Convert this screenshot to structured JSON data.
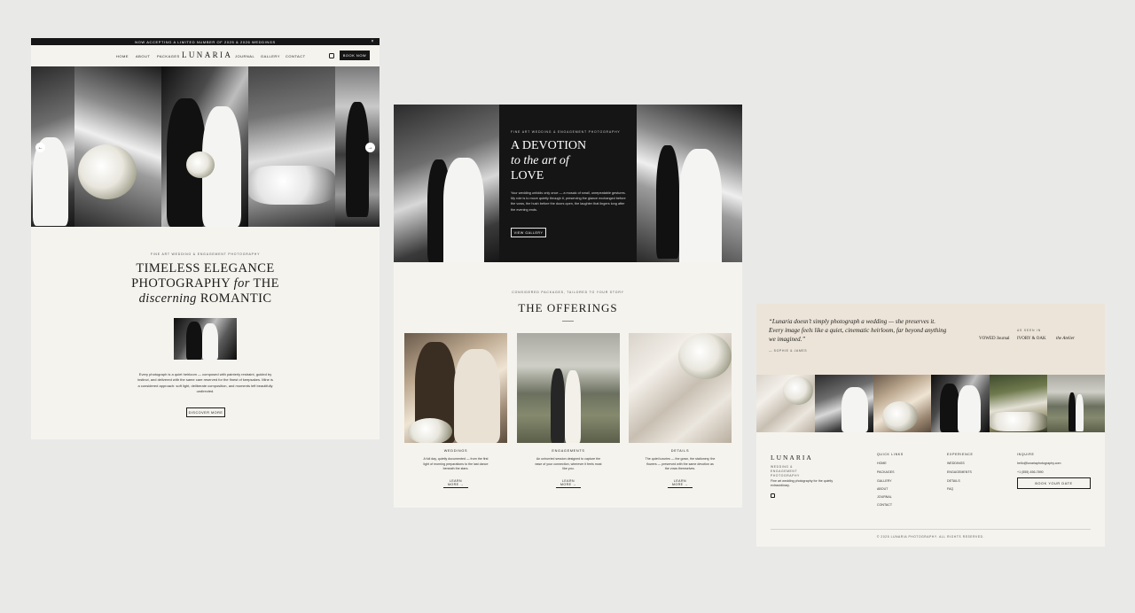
{
  "panel1": {
    "announcement": "NOW ACCEPTING A LIMITED NUMBER OF 2025 & 2026 WEDDINGS",
    "close_glyph": "×",
    "nav_left": [
      "HOME",
      "ABOUT",
      "PACKAGES"
    ],
    "logo": "LUNARIA",
    "nav_right": [
      "JOURNAL",
      "GALLERY",
      "CONTACT"
    ],
    "book_label": "BOOK NOW",
    "prev_glyph": "←",
    "next_glyph": "→",
    "eyebrow": "FINE ART WEDDING & ENGAGEMENT PHOTOGRAPHY",
    "headline": {
      "line1": "TIMELESS ELEGANCE",
      "line2a": "PHOTOGRAPHY ",
      "line2b": "for",
      "line2c": " THE",
      "line3a": "discerning",
      "line3b": " ROMANTIC"
    },
    "body": "Every photograph is a quiet heirloom — composed with painterly restraint, guided by instinct, and delivered with the same care reserved for the finest of keepsakes. Mine is a considered approach: soft light, deliberate composition, and moments left beautifully undirected.",
    "cta": "DISCOVER MORE"
  },
  "panel2": {
    "eyebrow": "FINE ART WEDDING & ENGAGEMENT PHOTOGRAPHY",
    "title": {
      "line1": "A DEVOTION",
      "line2": "to the art of",
      "line3": "LOVE"
    },
    "body": "Your wedding unfolds only once — a mosaic of small, unrepeatable gestures. My role is to move quietly through it, preserving the glance exchanged before the vows, the hush before the doors open, the laughter that lingers long after the evening ends.",
    "cta": "VIEW GALLERY",
    "section_eyebrow": "CONSIDERED PACKAGES, TAILORED TO YOUR STORY",
    "section_title": "THE OFFERINGS",
    "offerings": [
      {
        "title": "WEDDINGS",
        "body": "A full day, quietly documented — from the first light of morning preparations to the last dance beneath the stars.",
        "link": "LEARN MORE →"
      },
      {
        "title": "ENGAGEMENTS",
        "body": "An unhurried session designed to capture the ease of your connection, wherever it feels most like you.",
        "link": "LEARN MORE →"
      },
      {
        "title": "DETAILS",
        "body": "The quiet luxuries — the gown, the stationery, the flowers — preserved with the same devotion as the vows themselves.",
        "link": "LEARN MORE →"
      }
    ]
  },
  "panel3": {
    "quote": "“Lunaria doesn’t simply photograph a wedding — she preserves it. Every image feels like a quiet, cinematic heirloom, far beyond anything we imagined.”",
    "attribution": "— SOPHIE & JAMES",
    "seen_in_label": "AS SEEN IN",
    "press": [
      "VOWED Journal",
      "IVORY & OAK",
      "the Atelier"
    ],
    "footer": {
      "logo": "LUNARIA",
      "subtitle": "WEDDING & ENGAGEMENT PHOTOGRAPHY",
      "description": "Fine art wedding photography for the quietly extraordinary.",
      "quick_links_head": "QUICK LINKS",
      "quick_links": [
        "HOME",
        "PACKAGES",
        "GALLERY",
        "ABOUT",
        "JOURNAL",
        "CONTACT"
      ],
      "experience_head": "EXPERIENCE",
      "experience": [
        "WEDDINGS",
        "ENGAGEMENTS",
        "DETAILS",
        "FAQ"
      ],
      "inquire_head": "INQUIRE",
      "email": "hello@lunariaphotography.com",
      "phone": "+1 (555) 456-7890",
      "cta": "BOOK YOUR DATE",
      "copyright": "© 2025 LUNARIA PHOTOGRAPHY. ALL RIGHTS RESERVED."
    }
  }
}
